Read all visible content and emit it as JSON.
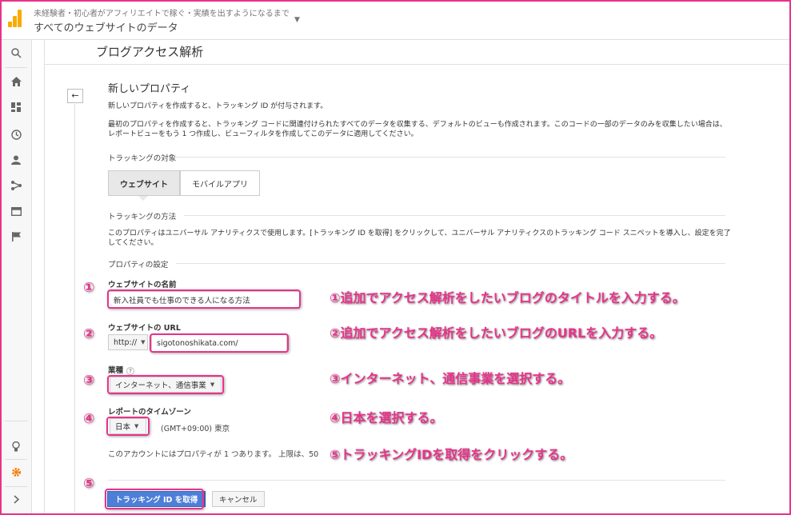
{
  "header": {
    "account": "未経験者・初心者がアフィリエイトで稼ぐ・実績を出すようになるまで",
    "property": "すべてのウェブサイトのデータ"
  },
  "nav": [
    "search-icon",
    "home-icon",
    "dashboard-icon",
    "clock-icon",
    "person-icon",
    "acquisition-icon",
    "behavior-icon",
    "flag-icon",
    "lightbulb-icon",
    "gear-icon",
    "chevron-right-icon"
  ],
  "page": {
    "title": "ブログアクセス解析",
    "back": "←"
  },
  "new_property": {
    "heading": "新しいプロパティ",
    "intro": "新しいプロパティを作成すると、トラッキング ID が付与されます。",
    "description": "最初のプロパティを作成すると、トラッキング コードに関連付けられたすべてのデータを収集する、デフォルトのビューも作成されます。このコードの一部のデータのみを収集したい場合は、レポートビューをもう 1 つ作成し、ビューフィルタを作成してこのデータに適用してください。"
  },
  "tracking_target": {
    "label": "トラッキングの対象",
    "options": [
      "ウェブサイト",
      "モバイルアプリ"
    ],
    "selected": "ウェブサイト"
  },
  "tracking_method": {
    "label": "トラッキングの方法",
    "description": "このプロパティはユニバーサル アナリティクスで使用します。[トラッキング ID を取得] をクリックして、ユニバーサル アナリティクスのトラッキング コード スニペットを導入し、設定を完了してください。"
  },
  "settings": {
    "label": "プロパティの設定",
    "site_name_label": "ウェブサイトの名前",
    "site_name_value": "新入社員でも仕事のできる人になる方法",
    "site_url_label": "ウェブサイトの URL",
    "protocol": "http://",
    "site_url_value": "sigotonoshikata.com/",
    "industry_label": "業種",
    "industry_value": "インターネット、通信事業",
    "timezone_label": "レポートのタイムゾーン",
    "timezone_country": "日本",
    "timezone_value": "(GMT+09:00) 東京",
    "limit_note": "このアカウントにはプロパティが 1 つあります。 上限は、50"
  },
  "buttons": {
    "get_tracking_id": "トラッキング ID を取得",
    "cancel": "キャンセル"
  },
  "annotations": {
    "markers": [
      "①",
      "②",
      "③",
      "④",
      "⑤"
    ],
    "notes": [
      "①追加でアクセス解析をしたいブログのタイトルを入力する。",
      "②追加でアクセス解析をしたいブログのURLを入力する。",
      "③インターネット、通信事業を選択する。",
      "④日本を選択する。",
      "⑤トラッキングIDを取得をクリックする。"
    ],
    "color": "#e8338a"
  }
}
